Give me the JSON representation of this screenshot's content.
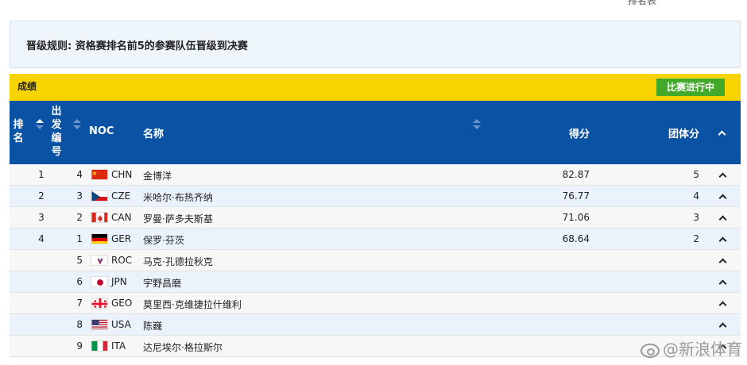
{
  "header": {
    "partial_text": "排名表"
  },
  "rule": {
    "text": "晋级规则: 资格赛排名前5的参赛队伍晋级到决赛"
  },
  "results": {
    "title": "成绩",
    "status": "比赛进行中"
  },
  "table": {
    "headers": {
      "rank": "排名",
      "bib": "出发编号",
      "noc": "NOC",
      "name": "名称",
      "score": "得分",
      "team_points": "团体分"
    },
    "rows": [
      {
        "rank": "1",
        "bib": "4",
        "noc": "CHN",
        "name": "金博洋",
        "score": "82.87",
        "team_points": "5",
        "flag": "chn-flag"
      },
      {
        "rank": "2",
        "bib": "3",
        "noc": "CZE",
        "name": "米哈尔·布热齐纳",
        "score": "76.77",
        "team_points": "4",
        "flag": "cze-flag"
      },
      {
        "rank": "3",
        "bib": "2",
        "noc": "CAN",
        "name": "罗曼·萨多夫斯基",
        "score": "71.06",
        "team_points": "3",
        "flag": "can-flag"
      },
      {
        "rank": "4",
        "bib": "1",
        "noc": "GER",
        "name": "保罗·芬茨",
        "score": "68.64",
        "team_points": "2",
        "flag": "ger-flag"
      },
      {
        "rank": "",
        "bib": "5",
        "noc": "ROC",
        "name": "马克·孔德拉秋克",
        "score": "",
        "team_points": "",
        "flag": "roc-flag"
      },
      {
        "rank": "",
        "bib": "6",
        "noc": "JPN",
        "name": "宇野昌磨",
        "score": "",
        "team_points": "",
        "flag": "jpn-flag"
      },
      {
        "rank": "",
        "bib": "7",
        "noc": "GEO",
        "name": "莫里西·克维捷拉什维利",
        "score": "",
        "team_points": "",
        "flag": "geo-flag"
      },
      {
        "rank": "",
        "bib": "8",
        "noc": "USA",
        "name": "陈巍",
        "score": "",
        "team_points": "",
        "flag": "usa-flag"
      },
      {
        "rank": "",
        "bib": "9",
        "noc": "ITA",
        "name": "达尼埃尔·格拉斯尔",
        "score": "",
        "team_points": "",
        "flag": "ita-flag"
      }
    ]
  },
  "watermark": {
    "text": "@新浪体育"
  },
  "colors": {
    "header_blue": "#0a52a3",
    "results_yellow": "#f7d400",
    "status_green": "#43a92b",
    "row_alt": "#eaf2fb"
  }
}
